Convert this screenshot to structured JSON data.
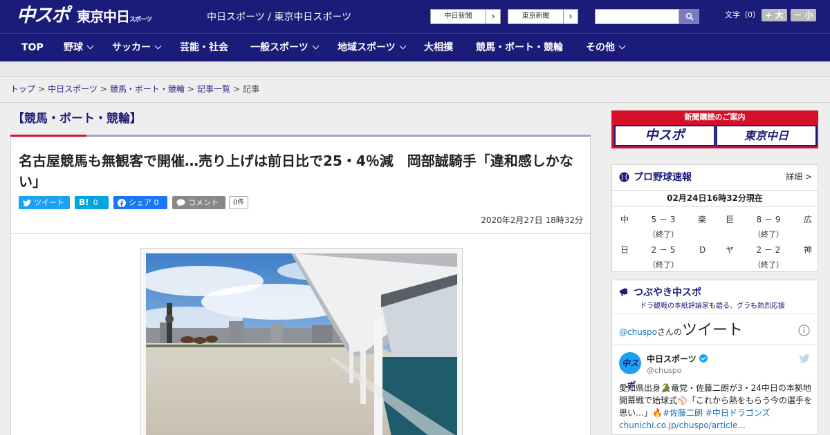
{
  "header": {
    "logo_chuspo": "中スポ",
    "logo_tokyo": "東京中日",
    "logo_tokyo_sub": "スポーツ",
    "site_title": "中日スポーツ / 東京中日スポーツ",
    "ext_links": [
      {
        "label": "中日新聞"
      },
      {
        "label": "東京新聞"
      }
    ],
    "search_placeholder": "",
    "font_size_label": "文字（0）",
    "font_larger": "+ 大",
    "font_smaller": "－ 小"
  },
  "nav": [
    {
      "label": "TOP",
      "dropdown": false
    },
    {
      "label": "野球",
      "dropdown": true
    },
    {
      "label": "サッカー",
      "dropdown": true
    },
    {
      "label": "芸能・社会",
      "dropdown": false
    },
    {
      "label": "一般スポーツ",
      "dropdown": true
    },
    {
      "label": "地域スポーツ",
      "dropdown": true
    },
    {
      "label": "大相撲",
      "dropdown": false
    },
    {
      "label": "競馬・ボート・競輪",
      "dropdown": false
    },
    {
      "label": "その他",
      "dropdown": true
    }
  ],
  "breadcrumb": {
    "items": [
      "トップ",
      "中日スポーツ",
      "競馬・ボート・競輪",
      "記事一覧"
    ],
    "current": "記事"
  },
  "article": {
    "category": "【競馬・ボート・競輪】",
    "headline": "名古屋競馬も無観客で開催…売り上げは前日比で25・4％減　岡部誠騎手「違和感しかない」",
    "share": {
      "tweet": "ツイート",
      "hatena_count": "0",
      "facebook": "シェア 0",
      "comment": "コメント",
      "comment_count": "0件"
    },
    "date": "2020年2月27日 18時32分"
  },
  "sidebar": {
    "promo_title": "新聞購読のご案内",
    "promo_chuspo": "中スポ",
    "promo_tokyo": "東京中日",
    "baseball": {
      "title": "プロ野球速報",
      "detail": "詳細 >",
      "timestamp": "02月24日16時32分現在",
      "games": [
        {
          "home": "中",
          "score": "5 － 3",
          "away": "楽",
          "status": "（終了）"
        },
        {
          "home": "巨",
          "score": "8 － 9",
          "away": "広",
          "status": "（終了）"
        },
        {
          "home": "日",
          "score": "2 － 5",
          "away": "D",
          "status": "（終了）"
        },
        {
          "home": "ヤ",
          "score": "2 － 2",
          "away": "神",
          "status": "（終了）"
        }
      ]
    },
    "tweets_box": {
      "title": "つぶやき中スポ",
      "subtitle": "ドラ観戦の本紙評論家も語る、グラも熱烈応援",
      "handle_prefix": "@chuspo",
      "handle_suffix": "さんの",
      "heading": "ツイート",
      "account_name": "中日スポーツ",
      "account_handle": "@chuspo",
      "tweet_text_1": "愛知県出身",
      "tweet_text_2": "竜党・佐藤二朗が3・24中日の本拠地開幕戦で始球式",
      "tweet_text_3": "「これから熱をもらう今の選手を思い…」",
      "hashtags": "#佐藤二朗 #中日ドラゴンズ",
      "link": "chunichi.co.jp/chuspo/article..."
    }
  },
  "colors": {
    "brand_navy": "#1b1b7a",
    "accent_red": "#d8102a",
    "twitter": "#1da1f2",
    "hatena": "#00a4de",
    "facebook": "#1877f2"
  }
}
